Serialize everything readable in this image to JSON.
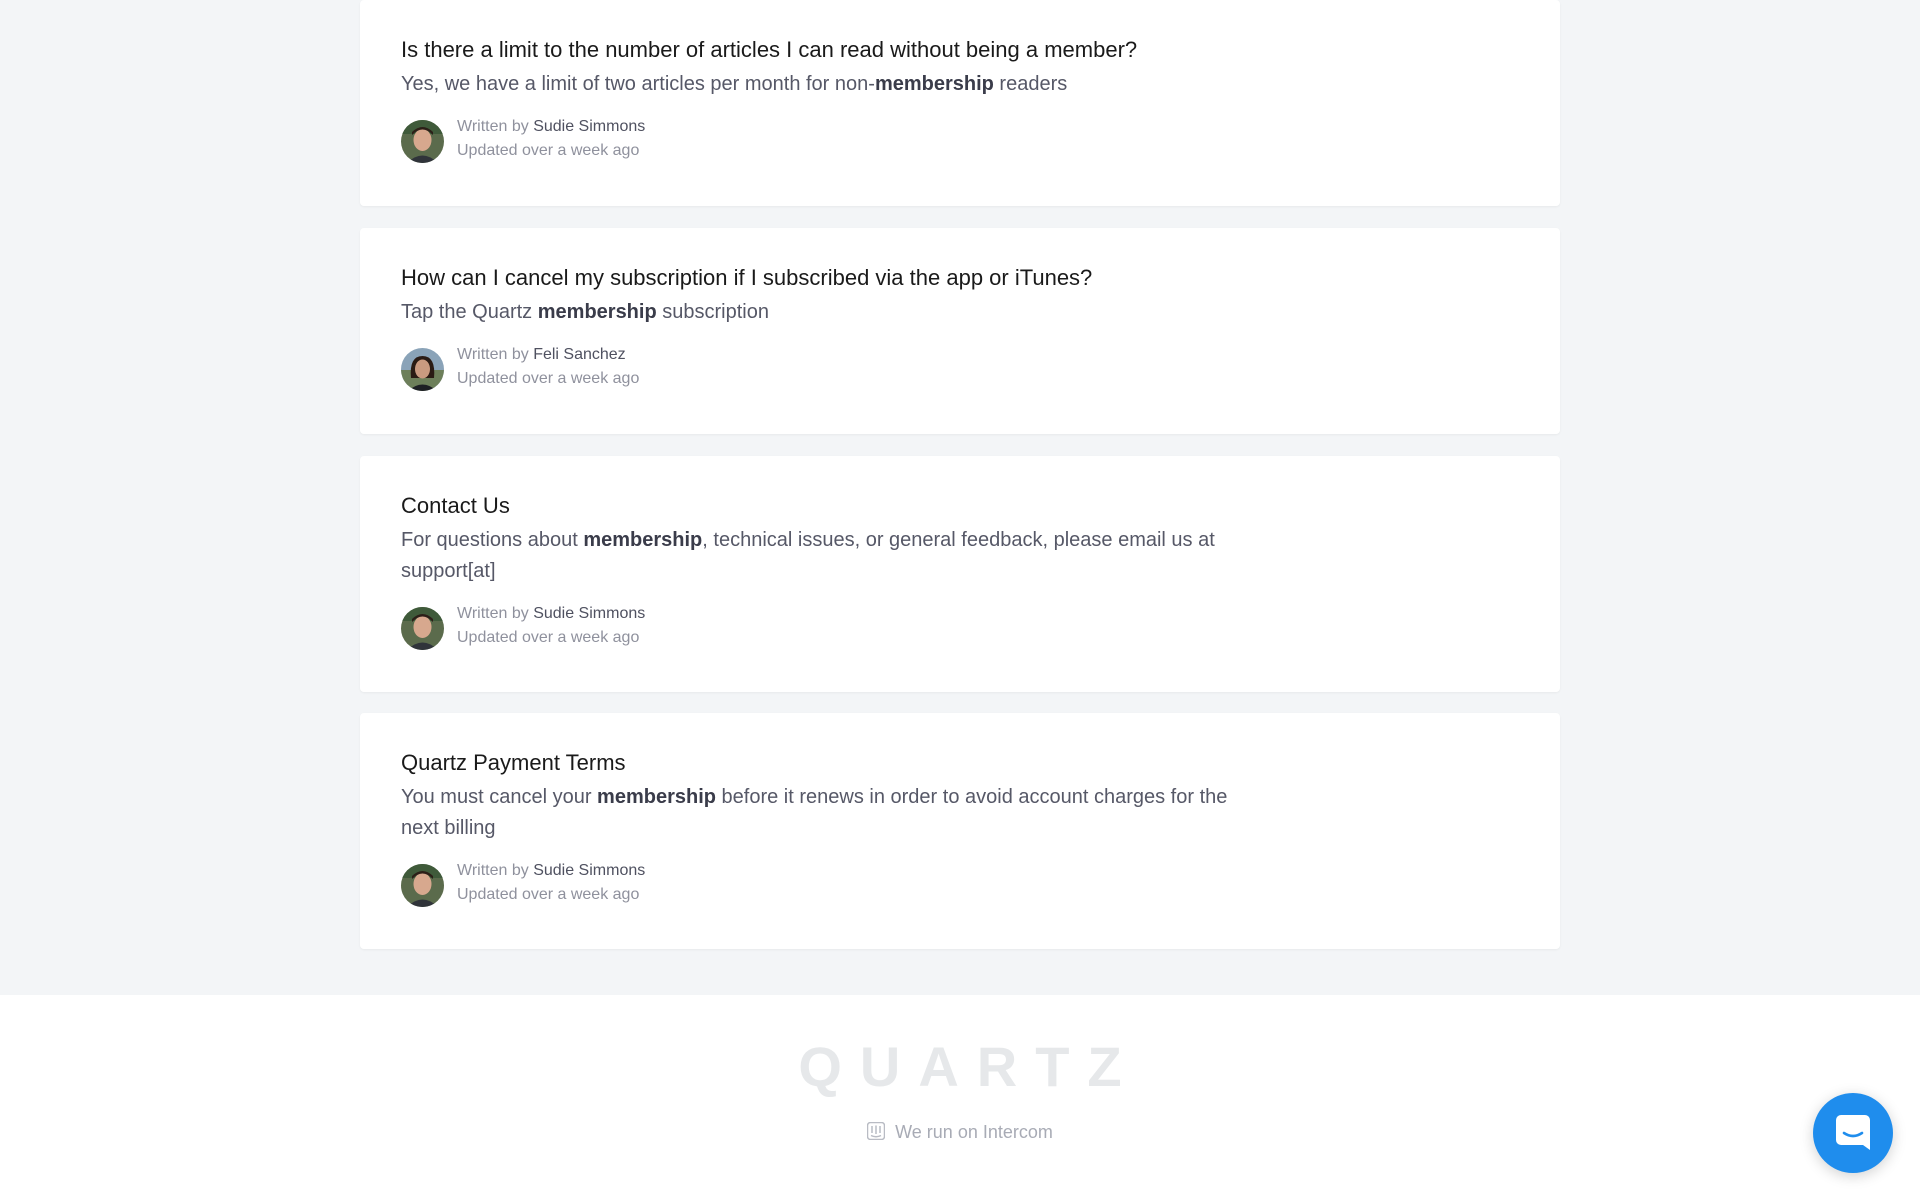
{
  "articles": [
    {
      "title": "Is there a limit to the number of articles I can read without being a member?",
      "desc_before": "Yes, we have a limit of two articles per month for non-",
      "desc_bold": "membership",
      "desc_after": " readers",
      "written_by_label": "Written by",
      "author": "Sudie Simmons",
      "updated": "Updated over a week ago",
      "avatar_icon": "author-photo-icon"
    },
    {
      "title": "How can I cancel my subscription if I subscribed via the app or iTunes?",
      "desc_before": "Tap the Quartz ",
      "desc_bold": "membership",
      "desc_after": " subscription",
      "written_by_label": "Written by",
      "author": "Feli Sanchez",
      "updated": "Updated over a week ago",
      "avatar_icon": "author-photo-icon"
    },
    {
      "title": "Contact Us",
      "desc_before": "For questions about ",
      "desc_bold": "membership",
      "desc_after": ", technical issues, or general feedback, please email us at support[at]",
      "written_by_label": "Written by",
      "author": "Sudie Simmons",
      "updated": "Updated over a week ago",
      "avatar_icon": "author-photo-icon"
    },
    {
      "title": "Quartz Payment Terms",
      "desc_before": "You must cancel your ",
      "desc_bold": "membership",
      "desc_after": " before it renews in order to avoid account charges for the next billing",
      "written_by_label": "Written by",
      "author": "Sudie Simmons",
      "updated": "Updated over a week ago",
      "avatar_icon": "author-photo-icon"
    }
  ],
  "footer": {
    "logo_text": "QUARTZ",
    "powered_text": "We run on Intercom",
    "powered_icon": "intercom-icon"
  },
  "launcher": {
    "icon": "chat-icon"
  },
  "colors": {
    "page_background": "#f3f5f7",
    "card_background": "#ffffff",
    "launcher_blue": "#1f8ded"
  }
}
